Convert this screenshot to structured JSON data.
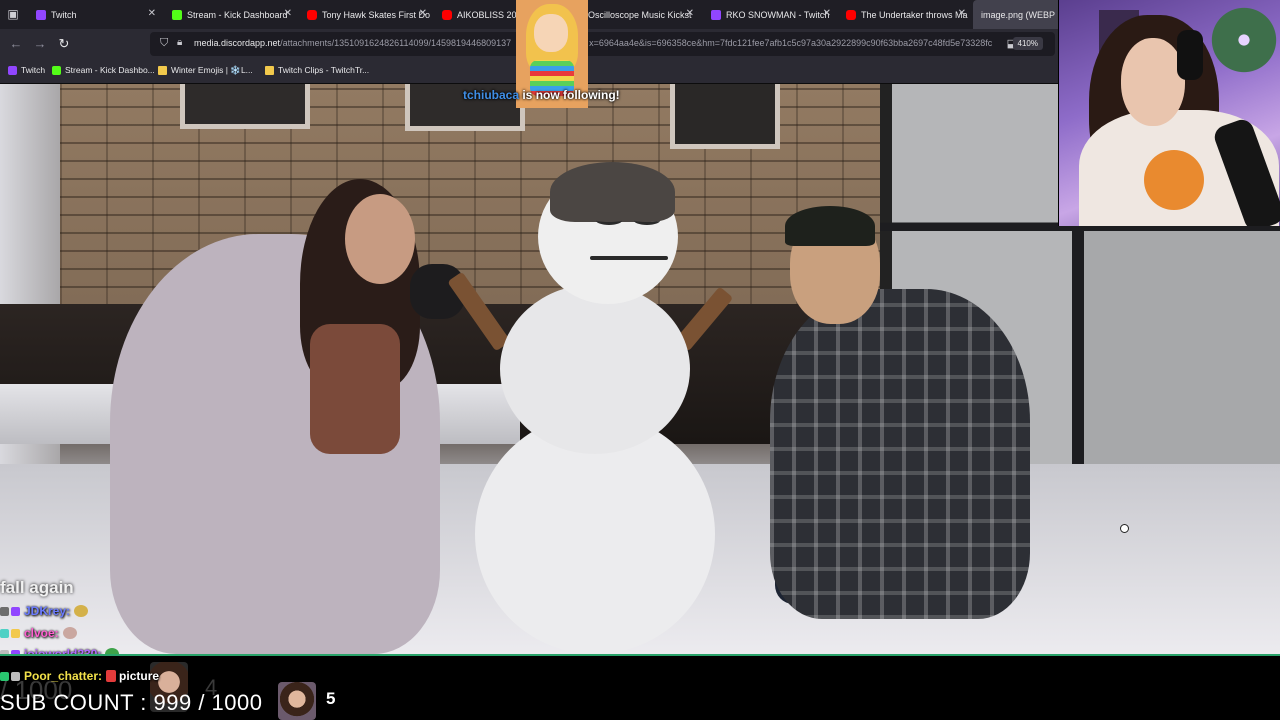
{
  "browser": {
    "tabs": [
      {
        "label": "Twitch",
        "favicon_color": "#9146ff",
        "active": false
      },
      {
        "label": "Stream - Kick Dashboard",
        "favicon_color": "#53fc18",
        "active": false
      },
      {
        "label": "Tony Hawk Skates First Do",
        "favicon_color": "#ff0000",
        "active": false
      },
      {
        "label": "AIKOBLISS 2025 F",
        "favicon_color": "#ff0000",
        "active": false
      },
      {
        "label": "Oscilloscope Music Kickst",
        "favicon_color": "#05ce78",
        "active": false
      },
      {
        "label": "RKO SNOWMAN - Twitch",
        "favicon_color": "#9146ff",
        "active": false
      },
      {
        "label": "The Undertaker throws Ma",
        "favicon_color": "#ff0000",
        "active": false
      },
      {
        "label": "image.png (WEBP Ima",
        "favicon_color": "#8f8f9d",
        "active": true
      }
    ],
    "url_host": "media.discordapp.net",
    "url_rest": "/attachments/1351091624826114099/1459819446809137",
    "url_tail": "x=6964aa4e&is=696358ce&hm=7fdc121fee7afb1c5c97a30a2922899c90f63bba2697c48fd5e73328fc",
    "zoom": "410%",
    "bookmarks": [
      {
        "label": "Twitch",
        "favicon_color": "#9146ff"
      },
      {
        "label": "Stream - Kick Dashbo...",
        "favicon_color": "#53fc18"
      },
      {
        "label": "Winter Emojis | ❄️L...",
        "favicon_color": "#f2c94c"
      },
      {
        "label": "Twitch Clips - TwitchTr...",
        "favicon_color": "#f2c94c"
      }
    ]
  },
  "alert": {
    "username": "tchiubaca",
    "message": " is now following!"
  },
  "chat": {
    "partial_message": "fall again",
    "lines": [
      {
        "name": "JDKrey:",
        "name_color": "#6b7bff",
        "badges": [
          "#6d6d6d",
          "#9146ff"
        ],
        "emote_color": "#d4b14a"
      },
      {
        "name": "clvoe:",
        "name_color": "#ff5fd0",
        "badges": [
          "#4fd1c5",
          "#f2c94c"
        ],
        "emote_color": "#caa7a0"
      },
      {
        "name": "jojoworld230:",
        "name_color": "#b06bff",
        "badges": [
          "#bdbdbd",
          "#9146ff"
        ],
        "emote_color": "#3ea34a"
      },
      {
        "name": "Poor_chatter:",
        "name_color": "#f2e14a",
        "badges": [
          "#29c56f",
          "#bdbdbd"
        ],
        "message": "picture",
        "emote_color": "#e33b3b"
      }
    ]
  },
  "overlay": {
    "sub_count": "SUB COUNT : 999 / 1000",
    "ghost_count": "/ 1000",
    "ghost_digit": "4",
    "count_value": "5"
  }
}
